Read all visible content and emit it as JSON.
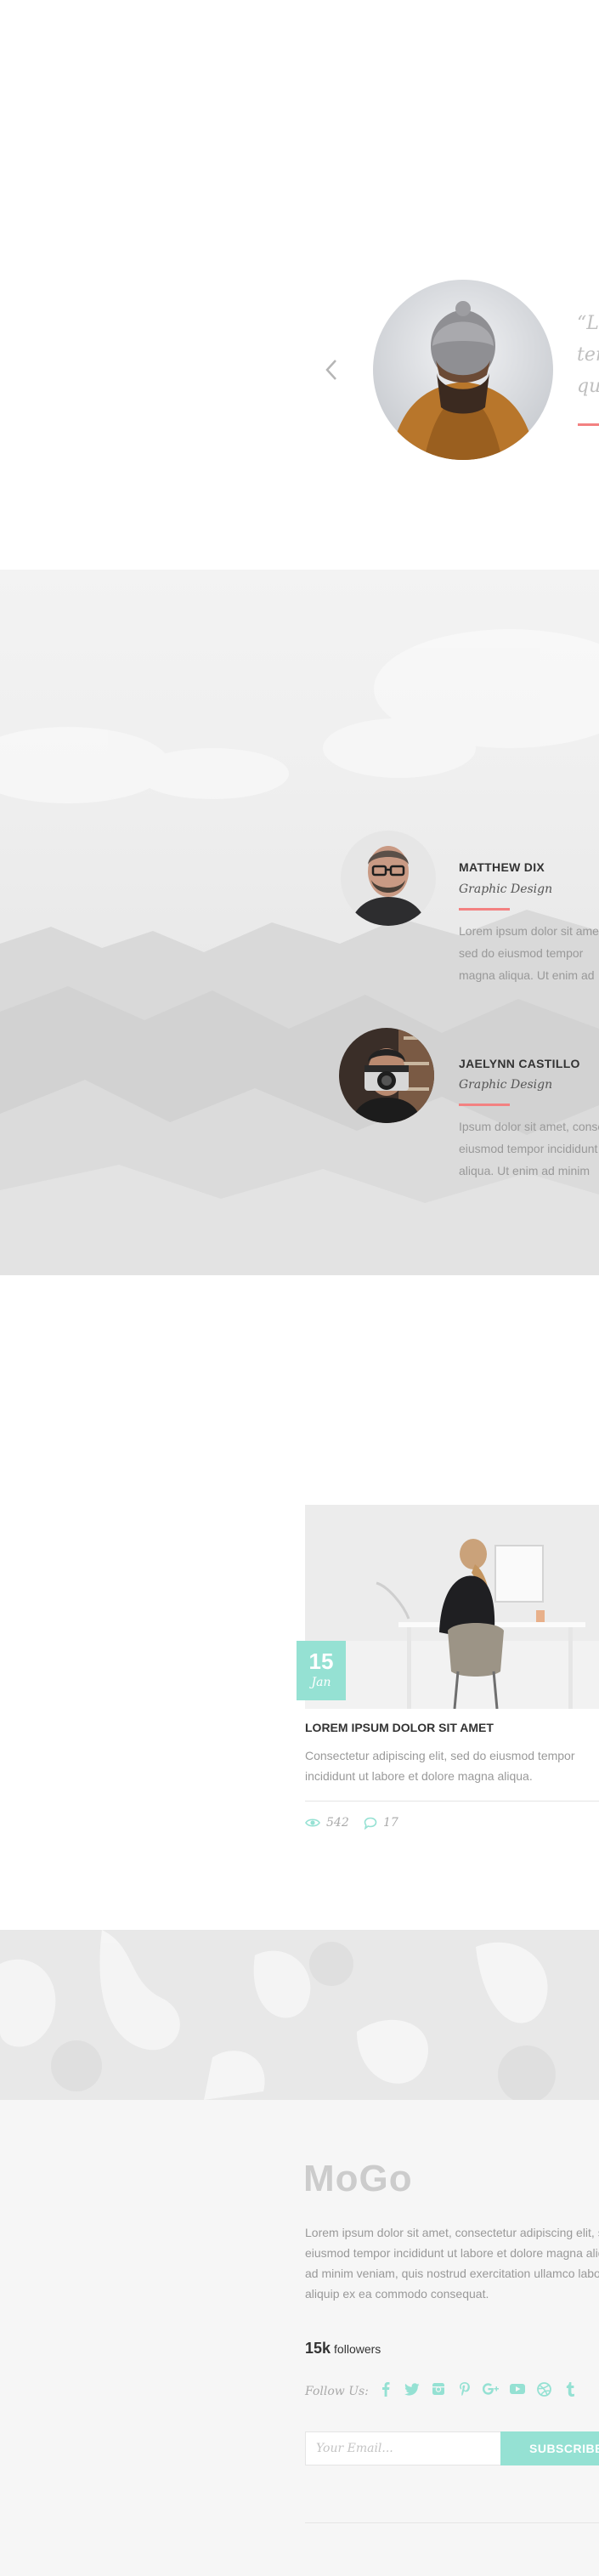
{
  "testimonial": {
    "quote_lines": [
      "“Lorem ipsum dolor sit amet,",
      "tempor incididunt ut labore",
      "quis nostrud exercitation"
    ],
    "prev_icon": "chevron-left-icon",
    "photo_icon": "person-in-beanie-photo"
  },
  "team": {
    "members": [
      {
        "name": "MATTHEW DIX",
        "role": "Graphic Design",
        "bio": [
          "Lorem ipsum dolor sit amet,",
          "sed do eiusmod tempor",
          "magna aliqua. Ut enim ad"
        ]
      },
      {
        "name": "JAELYNN CASTILLO",
        "role": "Graphic Design",
        "bio": [
          "Ipsum dolor sit amet, consectetur",
          "eiusmod tempor incididunt ut",
          "aliqua. Ut enim ad minim"
        ]
      }
    ],
    "accent_color": "#f38181"
  },
  "blog": {
    "post": {
      "day": "15",
      "month": "Jan",
      "title": "LOREM IPSUM DOLOR SIT AMET",
      "excerpt": [
        "Consectetur adipiscing elit, sed do eiusmod tempor",
        "incididunt ut labore et dolore magna aliqua."
      ],
      "views": "542",
      "comments": "17"
    },
    "accent_color": "#95e1d3"
  },
  "footer": {
    "logo": "MoGo",
    "about": [
      "Lorem ipsum dolor sit amet, consectetur adipiscing elit, sed do",
      "eiusmod tempor incididunt ut labore et dolore magna aliqua. Ut enim",
      "ad minim veniam, quis nostrud exercitation ullamco laboris nisi ut",
      "aliquip ex ea commodo consequat."
    ],
    "followers_count": "15k",
    "followers_label": "followers",
    "follow_label": "Follow Us:",
    "social_icons": [
      "facebook-icon",
      "twitter-icon",
      "instagram-icon",
      "pinterest-icon",
      "google-plus-icon",
      "youtube-icon",
      "dribbble-icon",
      "tumblr-icon"
    ],
    "email_placeholder": "Your Email...",
    "subscribe_label": "SUBSCRIBE"
  }
}
